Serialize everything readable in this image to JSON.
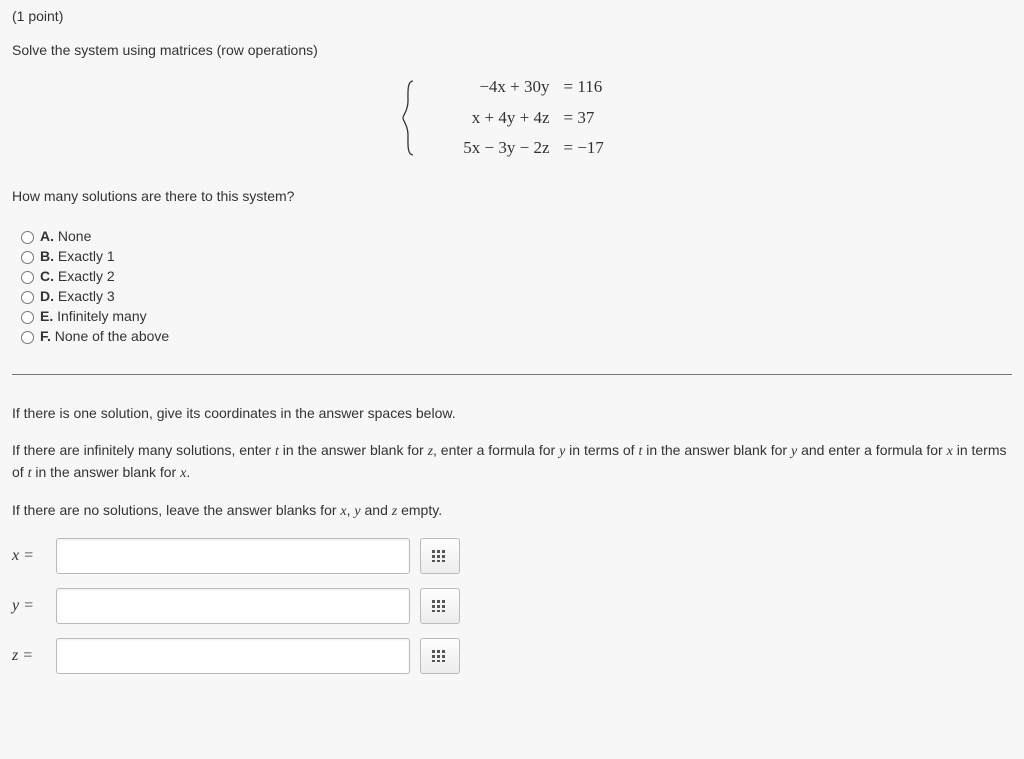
{
  "points": "(1 point)",
  "prompt": "Solve the system using matrices (row operations)",
  "equations": [
    {
      "lhs": "−4x + 30y",
      "rhs": "= 116"
    },
    {
      "lhs": "x + 4y + 4z",
      "rhs": "= 37"
    },
    {
      "lhs": "5x − 3y − 2z",
      "rhs": "= −17"
    }
  ],
  "subprompt": "How many solutions are there to this system?",
  "options": [
    {
      "letter": "A.",
      "text": "None"
    },
    {
      "letter": "B.",
      "text": "Exactly 1"
    },
    {
      "letter": "C.",
      "text": "Exactly 2"
    },
    {
      "letter": "D.",
      "text": "Exactly 3"
    },
    {
      "letter": "E.",
      "text": "Infinitely many"
    },
    {
      "letter": "F.",
      "text": "None of the above"
    }
  ],
  "instructions": {
    "p1_a": "If there is one solution, give its coordinates in the answer spaces below.",
    "p2_a": "If there are infinitely many solutions, enter ",
    "p2_b": " in the answer blank for ",
    "p2_c": ", enter a formula for ",
    "p2_d": " in terms of ",
    "p2_e": " in the answer blank for ",
    "p2_f": " and enter a formula for ",
    "p2_g": " in terms of ",
    "p2_h": " in the answer blank for ",
    "p2_i": ".",
    "p3_a": "If there are no solutions, leave the answer blanks for ",
    "p3_b": ", ",
    "p3_c": " and ",
    "p3_d": " empty."
  },
  "vars": {
    "t": "t",
    "x": "x",
    "y": "y",
    "z": "z"
  },
  "answers": {
    "x_label": "x =",
    "y_label": "y =",
    "z_label": "z =",
    "x_value": "",
    "y_value": "",
    "z_value": ""
  }
}
